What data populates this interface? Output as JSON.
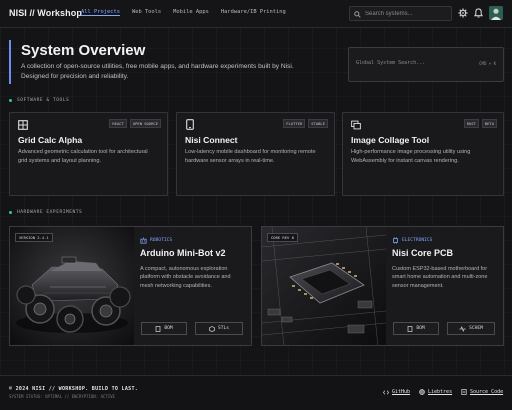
{
  "header": {
    "brand": "NISI // Workshop",
    "nav": [
      {
        "label": "All Projects",
        "active": true
      },
      {
        "label": "Web Tools",
        "active": false
      },
      {
        "label": "Mobile Apps",
        "active": false
      },
      {
        "label": "Hardware/IB Printing",
        "active": false
      }
    ],
    "search_placeholder": "Search systems...",
    "icons": [
      "search-icon",
      "gear-icon",
      "bell-icon",
      "avatar"
    ]
  },
  "hero": {
    "title": "System Overview",
    "description": "A collection of open-source utilities, free mobile apps, and hardware experiments built by Nisi. Designed for precision and reliability.",
    "global_search_placeholder": "Global System Search...",
    "shortcut": "CMD + K"
  },
  "software": {
    "label": "SOFTWARE & TOOLS",
    "cards": [
      {
        "title": "Grid Calc Alpha",
        "description": "Advanced geometric calculation tool for architectural grid systems and layout planning.",
        "tags": [
          "REACT",
          "OPEN SOURCE"
        ],
        "icon": "grid-icon"
      },
      {
        "title": "Nisi Connect",
        "description": "Low-latency mobile dashboard for monitoring remote hardware sensor arrays in real-time.",
        "tags": [
          "FLUTTER",
          "STABLE"
        ],
        "icon": "phone-icon"
      },
      {
        "title": "Image Collage Tool",
        "description": "High-performance image processing utility using WebAssembly for instant canvas rendering.",
        "tags": [
          "RUST",
          "BETA"
        ],
        "icon": "images-icon"
      }
    ]
  },
  "hardware": {
    "label": "HARDWARE EXPERIMENTS",
    "cards": [
      {
        "badge": "VERSION 2.4.1",
        "category": "ROBOTICS",
        "title": "Arduino Mini-Bot v2",
        "description": "A compact, autonomous exploration platform with obstacle avoidance and mesh networking capabilities.",
        "buttons": [
          "BOM",
          "STLs"
        ]
      },
      {
        "badge": "CORE REV 8",
        "category": "ELECTRONICS",
        "title": "Nisi Core PCB",
        "description": "Custom ESP32-based motherboard for smart home automation and multi-zone sensor management.",
        "buttons": [
          "BOM",
          "SCHEM"
        ]
      }
    ]
  },
  "footer": {
    "copyright": "© 2024 NISI // WORKSHOP. BUILD TO LAST.",
    "status": "SYSTEM STATUS: OPTIMAL // ENCRYPTION: ACTIVE",
    "links": [
      "GitHub",
      "Liebtres",
      "Source Code"
    ]
  },
  "colors": {
    "accent": "#7fa8ff",
    "hero_bar": "#6e8ef5",
    "status_dot": "#3ec28f"
  }
}
